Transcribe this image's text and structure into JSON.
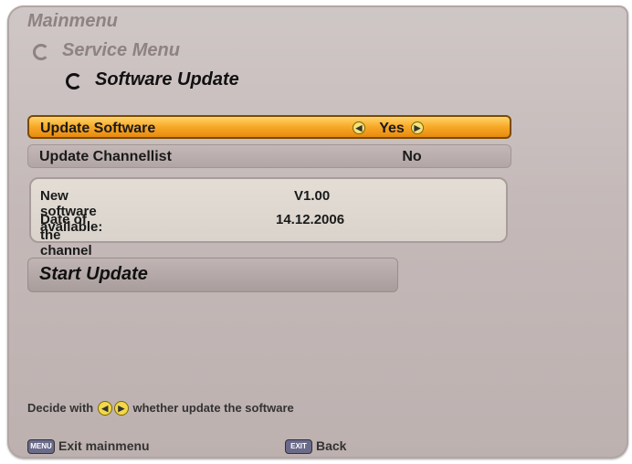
{
  "breadcrumb": [
    "Mainmenu",
    "Service Menu",
    "Software Update"
  ],
  "menu": [
    {
      "label": "Update Software",
      "value": "Yes",
      "selected": true
    },
    {
      "label": "Update Channellist",
      "value": "No",
      "selected": false
    }
  ],
  "info": {
    "rows": [
      {
        "label": "New software available:",
        "value": "V1.00"
      },
      {
        "label": "Date of the channel list:",
        "value": "14.12.2006"
      }
    ]
  },
  "start_label": "Start Update",
  "hint": {
    "prefix": "Decide with",
    "suffix": "whether update the software"
  },
  "footer": [
    {
      "key": "MENU",
      "label": "Exit mainmenu"
    },
    {
      "key": "EXIT",
      "label": "Back"
    }
  ],
  "colors": {
    "highlight": "#f7a826",
    "panel": "#c4b9b8"
  },
  "icons": [
    "back-arrow-icon",
    "left-arrow-icon",
    "right-arrow-icon",
    "menu-key-icon",
    "exit-key-icon"
  ]
}
